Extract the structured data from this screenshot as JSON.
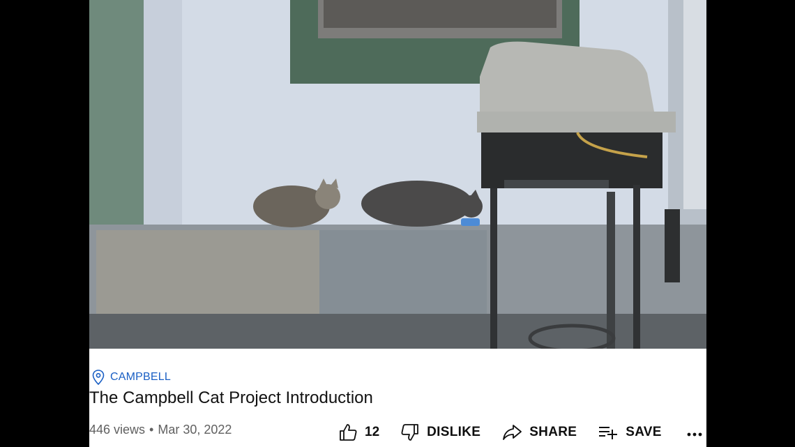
{
  "video": {
    "scene": "cats-on-porch-ledge"
  },
  "location": {
    "icon": "location-pin-icon",
    "text": "CAMPBELL",
    "color": "#1a5fc4"
  },
  "title": "The Campbell Cat Project Introduction",
  "stats": {
    "views": "446 views",
    "separator": "•",
    "date": "Mar 30, 2022"
  },
  "actions": {
    "like": {
      "icon": "thumbs-up-icon",
      "count": "12"
    },
    "dislike": {
      "icon": "thumbs-down-icon",
      "label": "DISLIKE"
    },
    "share": {
      "icon": "share-arrow-icon",
      "label": "SHARE"
    },
    "save": {
      "icon": "playlist-add-icon",
      "label": "SAVE"
    },
    "more": {
      "icon": "more-dots-icon"
    }
  }
}
